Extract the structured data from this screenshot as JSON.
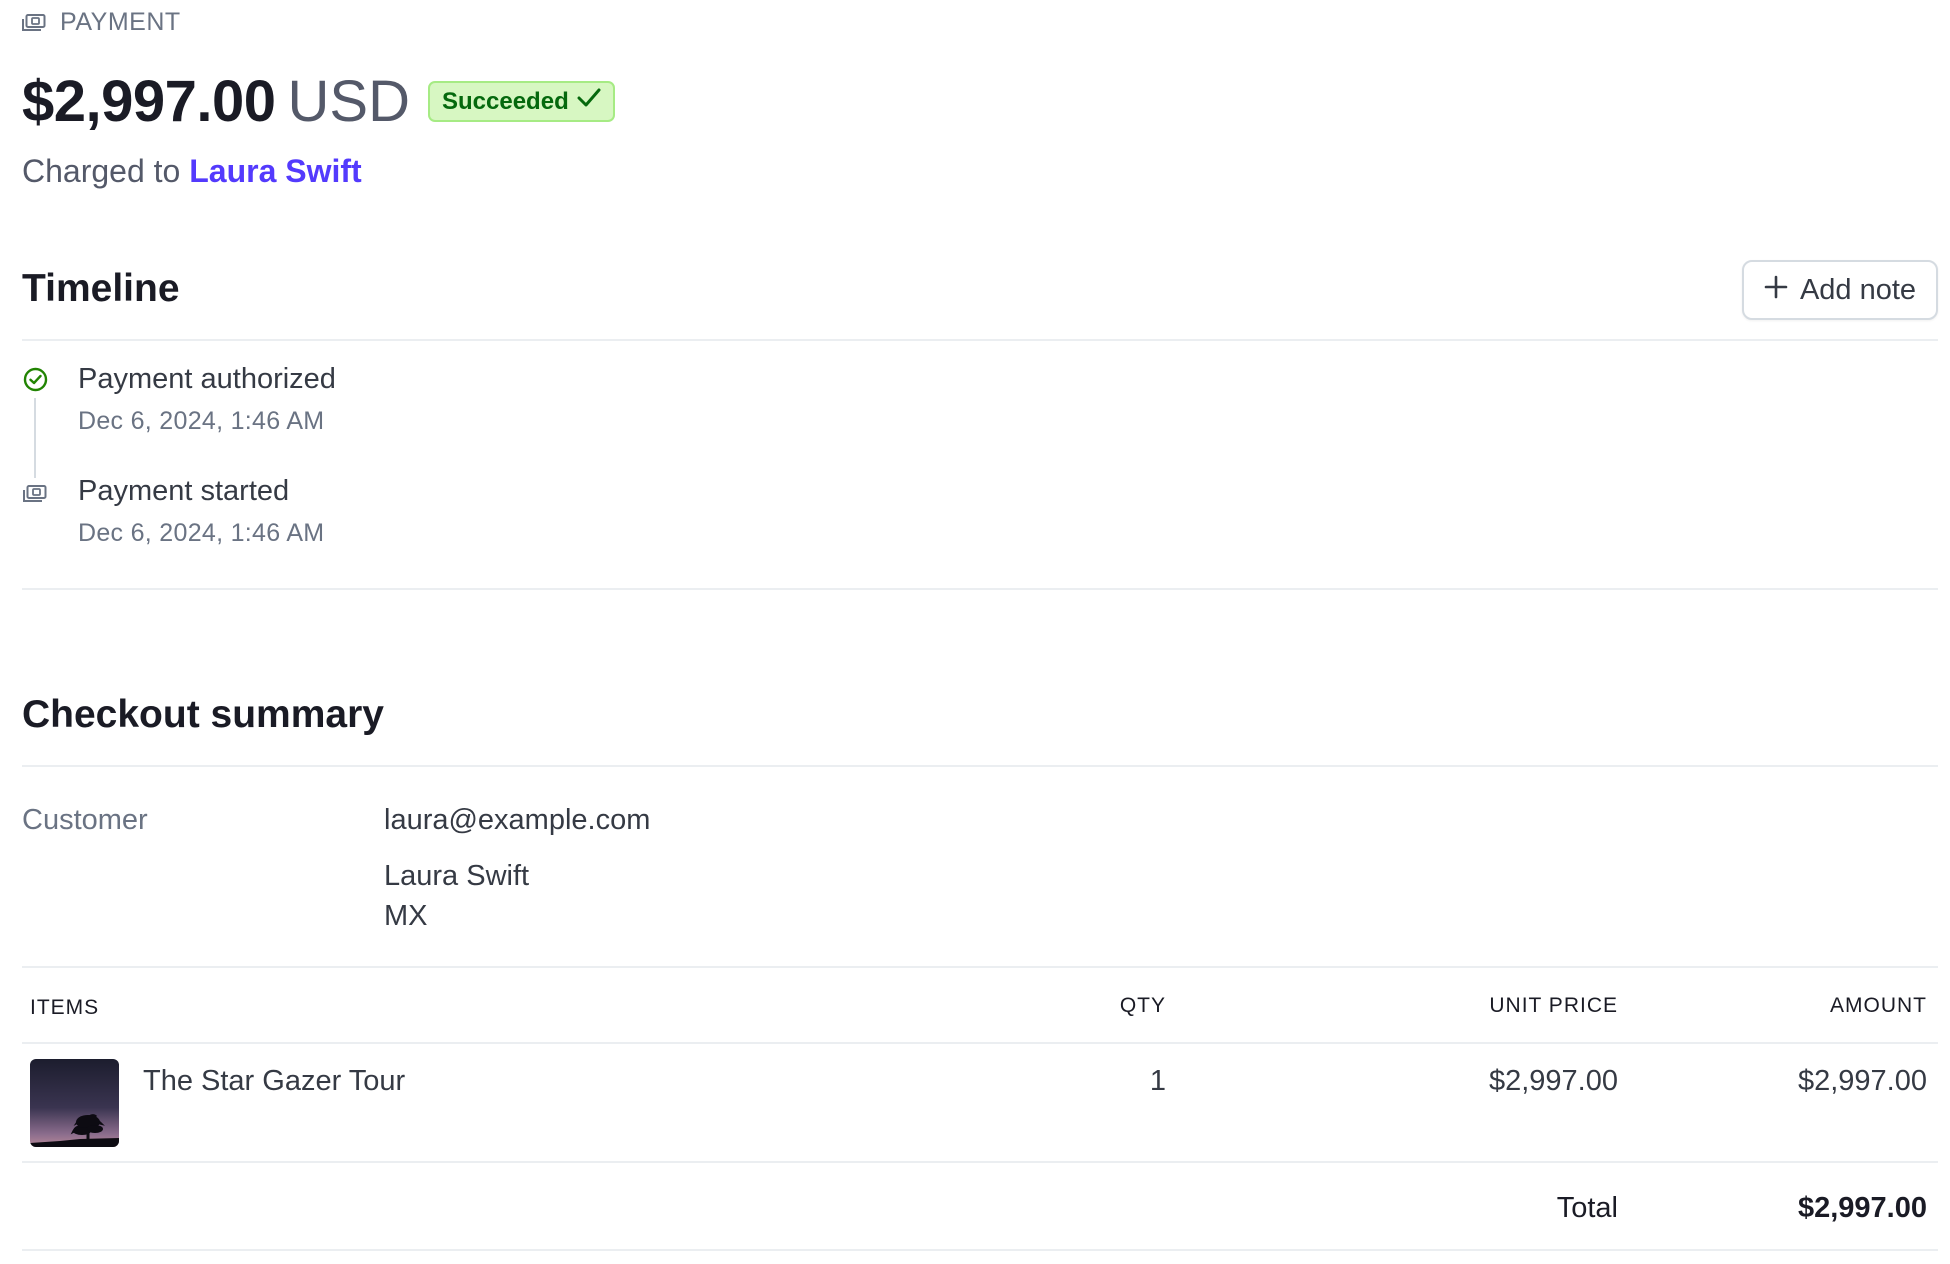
{
  "header": {
    "section_label": "PAYMENT",
    "amount": "$2,997.00",
    "currency": "USD",
    "status": "Succeeded",
    "charged_prefix": "Charged to",
    "customer_name": "Laura Swift"
  },
  "timeline": {
    "title": "Timeline",
    "add_note_label": "Add note",
    "events": [
      {
        "title": "Payment authorized",
        "date": "Dec 6, 2024, 1:46 AM",
        "icon": "check-circle-icon"
      },
      {
        "title": "Payment started",
        "date": "Dec 6, 2024, 1:46 AM",
        "icon": "payment-icon"
      }
    ]
  },
  "checkout": {
    "title": "Checkout summary",
    "customer_label": "Customer",
    "customer_email": "laura@example.com",
    "customer_name": "Laura Swift",
    "customer_country": "MX",
    "table": {
      "columns": {
        "items": "ITEMS",
        "qty": "QTY",
        "unit_price": "UNIT PRICE",
        "amount": "AMOUNT"
      },
      "rows": [
        {
          "name": "The Star Gazer Tour",
          "qty": "1",
          "unit_price": "$2,997.00",
          "amount": "$2,997.00"
        }
      ],
      "total_label": "Total",
      "total_value": "$2,997.00"
    }
  },
  "colors": {
    "accent": "#533afd",
    "success_bg": "#d7f7c2",
    "success_text": "#05690d",
    "muted": "#6a7383"
  }
}
